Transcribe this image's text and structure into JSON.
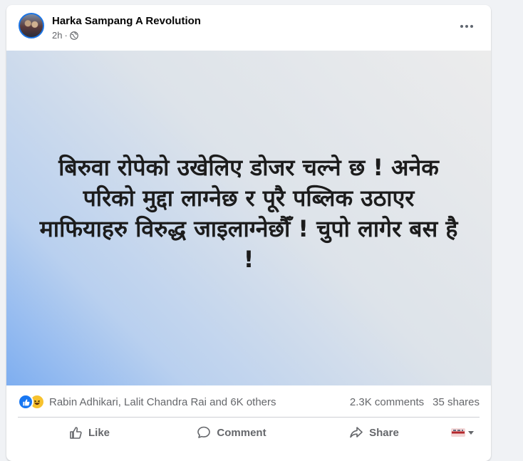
{
  "post": {
    "author": "Harka Sampang A Revolution",
    "time": "2h",
    "separator": "·",
    "visibility_icon": "globe-icon",
    "more_icon": "more-options-icon",
    "text_lines": [
      "बिरुवा रोपेको उखेलिए डोजर चल्ने छ ! अनेक",
      "परिको मुद्दा लाग्नेछ र पूरै पब्लिक उठाएर",
      "माफियाहरु विरुद्ध जाइलाग्नेछौँ ! चुपो लागेर बस है",
      "!"
    ],
    "background_colors": [
      "#ececec",
      "#dde3ea",
      "#b9d0ef",
      "#7eaef0"
    ]
  },
  "reactions": {
    "icons": [
      "like-reaction-icon",
      "haha-reaction-icon"
    ],
    "names": "Rabin Adhikari, Lalit Chandra Rai and 6K others",
    "comments": "2.3K comments",
    "shares": "35 shares"
  },
  "actions": {
    "like_label": "Like",
    "comment_label": "Comment",
    "share_label": "Share"
  },
  "colors": {
    "accent": "#1877f2",
    "text_secondary": "#65676b",
    "haha": "#f7c22e"
  }
}
